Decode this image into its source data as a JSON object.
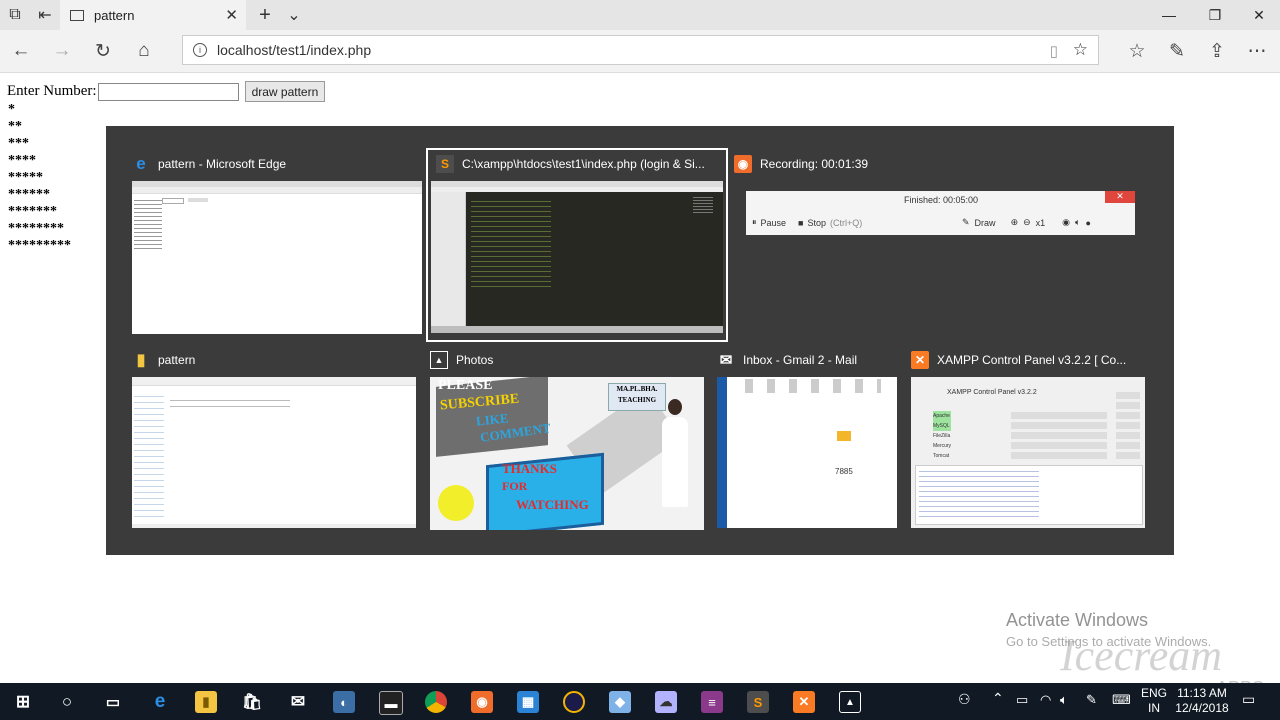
{
  "browser": {
    "tab_title": "pattern",
    "address_url": "localhost/test1/index.php",
    "new_tab_symbol": "+",
    "close_symbol": "✕"
  },
  "page": {
    "label": "Enter Number:",
    "input_value": "",
    "button_label": "draw pattern",
    "pattern_rows": [
      "*",
      "**",
      "***",
      "****",
      "*****",
      "******",
      "*******",
      "********",
      "*********"
    ]
  },
  "taskview": {
    "windows": [
      {
        "title": "pattern - Microsoft Edge",
        "icon": "edge-icon"
      },
      {
        "title": "C:\\xampp\\htdocs\\test1\\index.php (login & Si...",
        "icon": "sublime-icon"
      },
      {
        "title": "Recording:  00:01:39",
        "icon": "recorder-icon"
      },
      {
        "title": "pattern",
        "icon": "folder-icon"
      },
      {
        "title": "Photos",
        "icon": "photos-icon"
      },
      {
        "title": "Inbox - Gmail 2 - Mail",
        "icon": "mail-icon"
      },
      {
        "title": "XAMPP Control Panel v3.2.2   [ Co...",
        "icon": "xampp-icon"
      }
    ],
    "recorder": {
      "finished": "Finished:  00:05:00",
      "pause": "Pause",
      "stop": "Stop",
      "stop_hint": "(Ctrl+Q)",
      "draw": "Draw",
      "speed": "x1"
    },
    "photo": {
      "please": "PLEASE",
      "subscribe": "SUBSCRIBE",
      "like": "LIKE",
      "comment": "COMMENT",
      "thanks": "THANKS",
      "for": "FOR",
      "watching": "WATCHING",
      "tag1": "MA.PL.BHA.",
      "tag2": "TEACHING"
    },
    "mail": {
      "code": "7885"
    },
    "xampp": {
      "title": "XAMPP Control Panel v3.2.2",
      "modules": [
        "Apache",
        "MySQL",
        "FileZilla",
        "Mercury",
        "Tomcat"
      ]
    }
  },
  "taskbar": {
    "lang1": "ENG",
    "lang2": "IN",
    "time": "11:13 AM",
    "date": "12/4/2018"
  },
  "watermark": {
    "line1": "Activate Windows",
    "line2": "Go to Settings to activate Windows.",
    "brand": "Icecream",
    "brand2": "APPS"
  }
}
